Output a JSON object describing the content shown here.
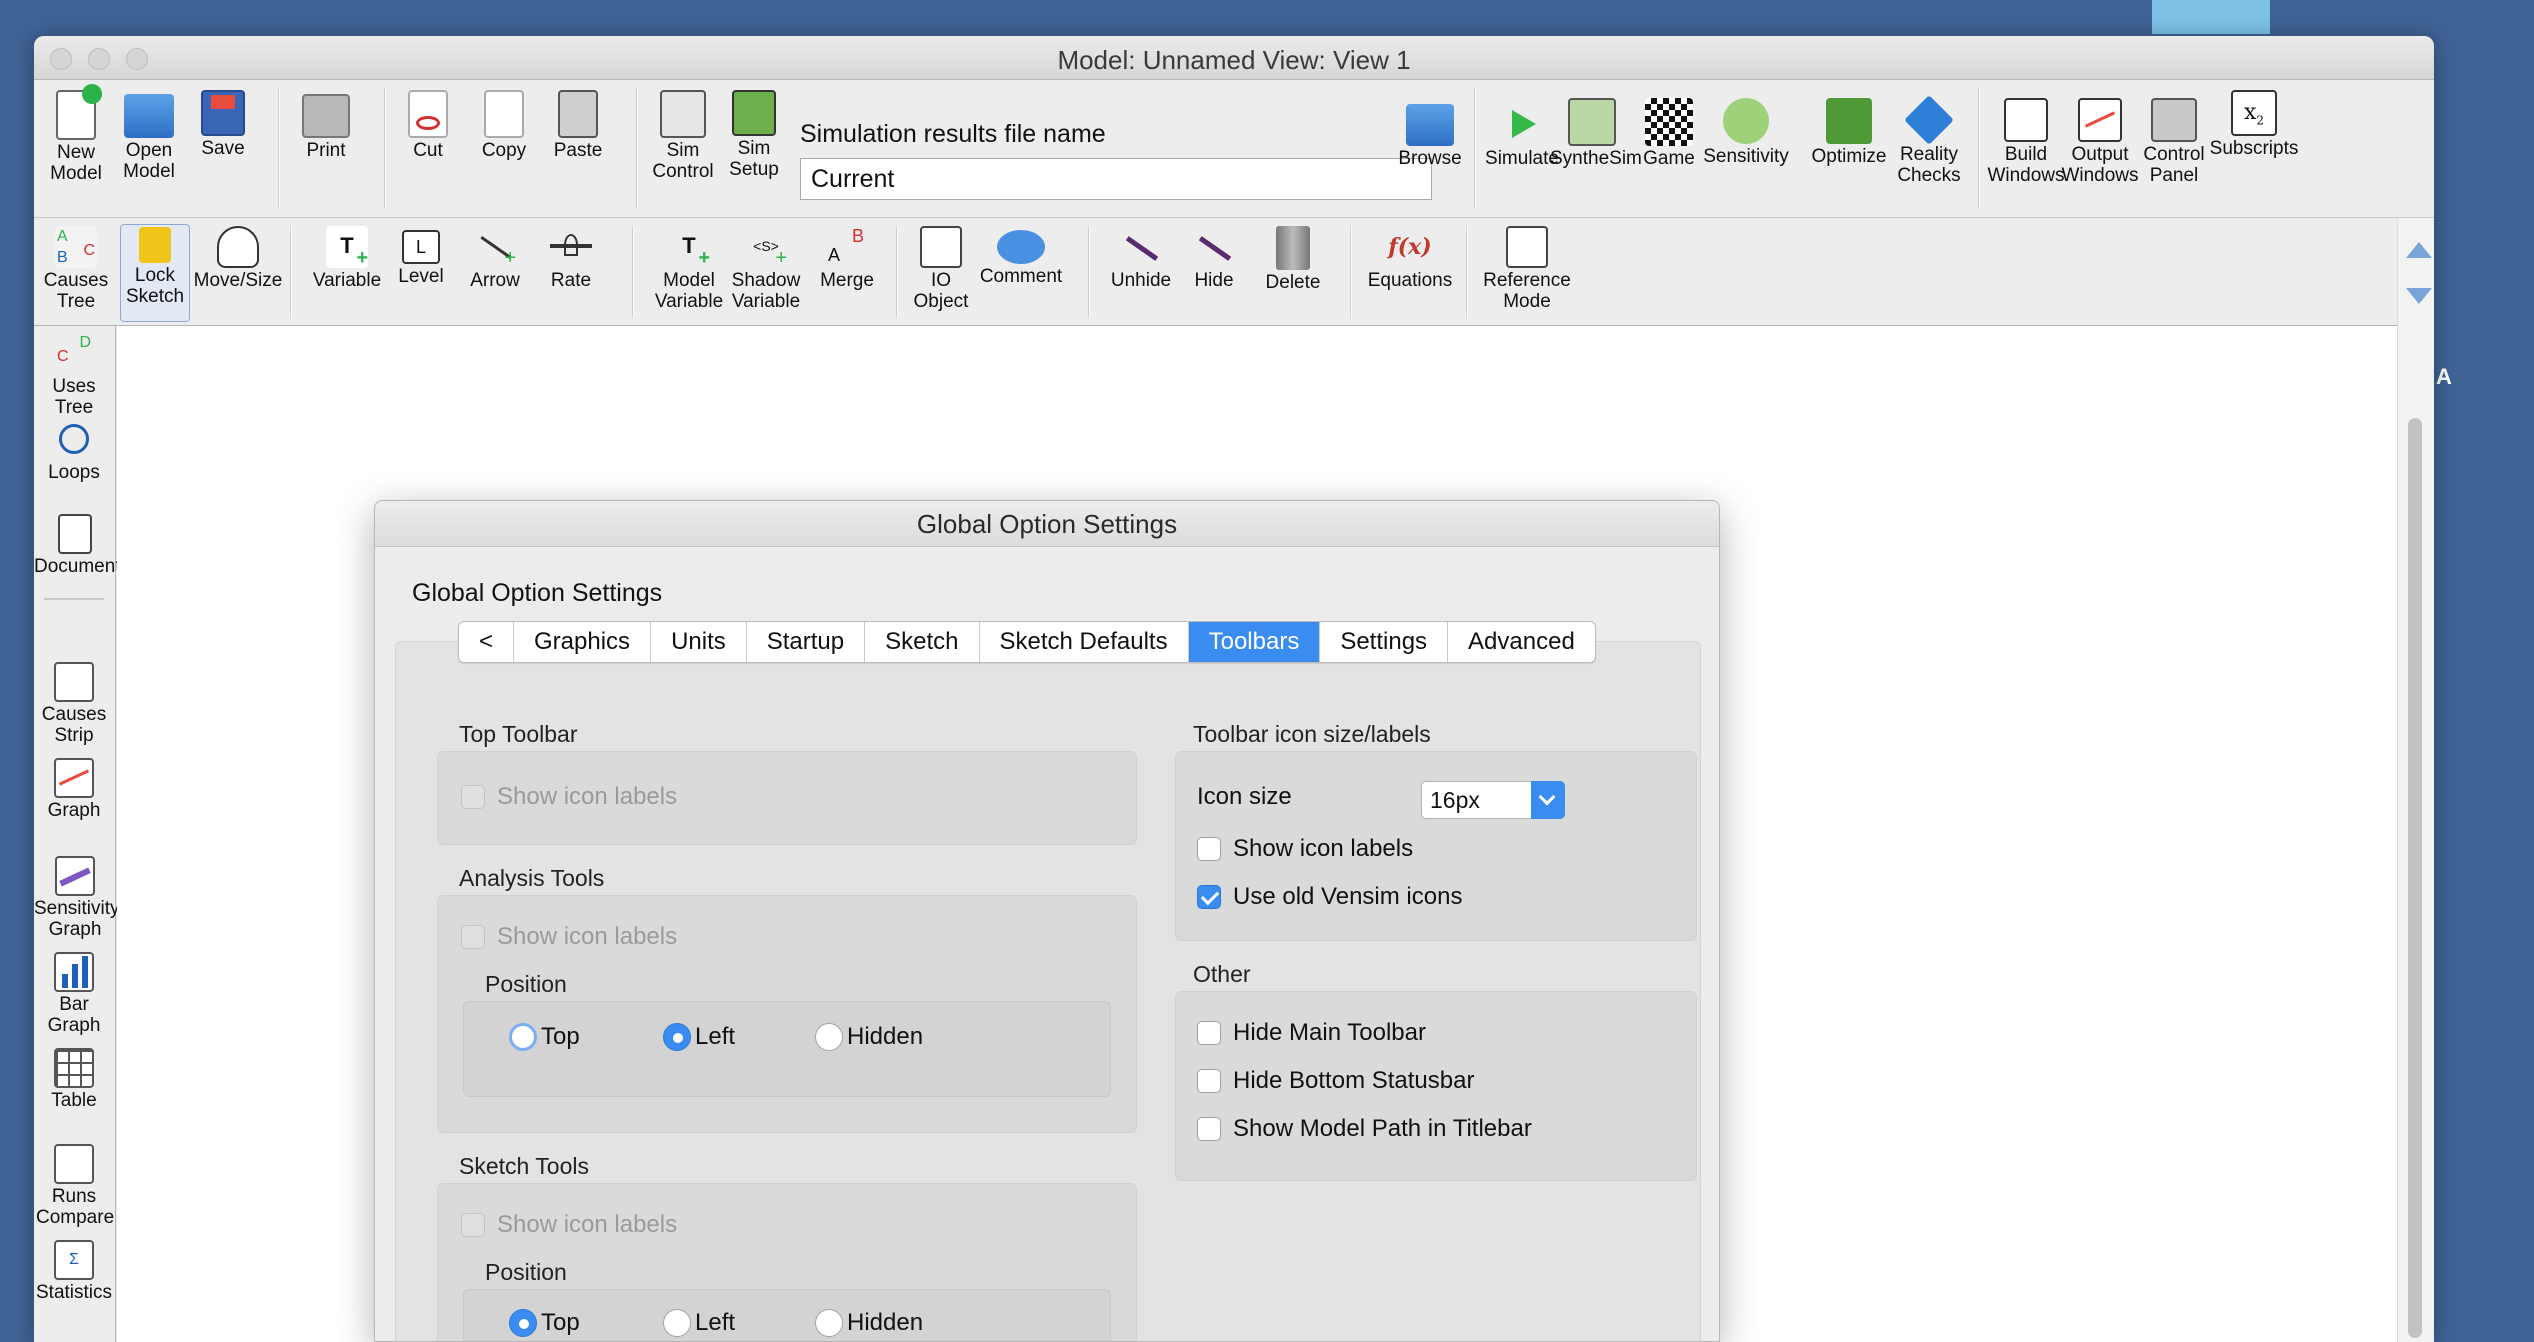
{
  "window": {
    "title": "Model: Unnamed View: View 1"
  },
  "toolbar_top": {
    "new_model": "New\nModel",
    "open_model": "Open\nModel",
    "save": "Save",
    "print": "Print",
    "cut": "Cut",
    "copy": "Copy",
    "paste": "Paste",
    "sim_control": "Sim\nControl",
    "sim_setup": "Sim\nSetup",
    "sim_file_label": "Simulation results file name",
    "sim_file_value": "Current",
    "browse": "Browse",
    "simulate": "Simulate",
    "synthesim": "SyntheSim",
    "game": "Game",
    "sensitivity": "Sensitivity",
    "optimize": "Optimize",
    "reality_checks": "Reality\nChecks",
    "build_windows": "Build\nWindows",
    "output_windows": "Output\nWindows",
    "control_panel": "Control\nPanel",
    "subscripts": "Subscripts"
  },
  "toolbar_sketch": {
    "causes_tree": "Causes\nTree",
    "lock_sketch": "Lock\nSketch",
    "move_size": "Move/Size",
    "variable": "Variable",
    "level": "Level",
    "arrow": "Arrow",
    "rate": "Rate",
    "model_variable": "Model\nVariable",
    "shadow_variable": "Shadow\nVariable",
    "merge": "Merge",
    "io_object": "IO\nObject",
    "comment": "Comment",
    "unhide": "Unhide",
    "hide": "Hide",
    "delete": "Delete",
    "equations": "Equations",
    "reference_mode": "Reference\nMode"
  },
  "sidebar": {
    "uses_tree": "Uses\nTree",
    "loops": "Loops",
    "document": "Document",
    "causes_strip": "Causes\nStrip",
    "graph": "Graph",
    "sensitivity_graph": "Sensitivity\nGraph",
    "bar_graph": "Bar\nGraph",
    "table": "Table",
    "runs_compare": "Runs\nCompare",
    "statistics": "Statistics"
  },
  "right_edge_letter": "A",
  "dialog": {
    "title": "Global Option Settings",
    "heading": "Global Option Settings",
    "tabs": [
      "<",
      "Graphics",
      "Units",
      "Startup",
      "Sketch",
      "Sketch Defaults",
      "Toolbars",
      "Settings",
      "Advanced"
    ],
    "active_tab": "Toolbars",
    "top_toolbar": {
      "label": "Top Toolbar",
      "show_icon_labels": "Show icon labels"
    },
    "analysis_tools": {
      "label": "Analysis Tools",
      "show_icon_labels": "Show icon labels",
      "position_label": "Position",
      "options": [
        "Top",
        "Left",
        "Hidden"
      ],
      "selected": "Left"
    },
    "sketch_tools": {
      "label": "Sketch Tools",
      "show_icon_labels": "Show icon labels",
      "position_label": "Position",
      "options": [
        "Top",
        "Left",
        "Hidden"
      ],
      "selected": "Top"
    },
    "icon_size_group": {
      "label": "Toolbar icon size/labels",
      "icon_size_label": "Icon size",
      "icon_size_value": "16px",
      "show_icon_labels": "Show icon labels",
      "show_icon_labels_checked": false,
      "use_old_icons": "Use old Vensim icons",
      "use_old_icons_checked": true
    },
    "other": {
      "label": "Other",
      "hide_main_toolbar": "Hide Main Toolbar",
      "hide_bottom_statusbar": "Hide Bottom Statusbar",
      "show_model_path": "Show Model Path in Titlebar"
    }
  },
  "colors": {
    "accent": "#3b8cf1",
    "desktop": "#3f6396"
  }
}
